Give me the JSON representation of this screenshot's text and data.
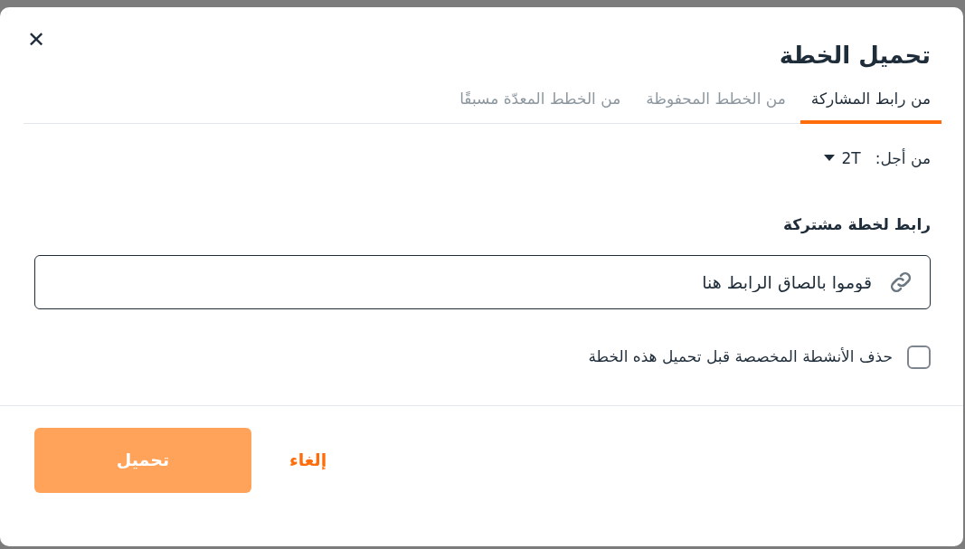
{
  "dialog": {
    "title": "تحميل الخطة",
    "close": "✕"
  },
  "tabs": [
    {
      "label": "من رابط المشاركة",
      "selected": true
    },
    {
      "label": "من الخطط المحفوظة",
      "selected": false
    },
    {
      "label": "من الخطط المعدّة مسبقًا",
      "selected": false
    }
  ],
  "for_selector": {
    "label": "من أجل:",
    "value": "2T"
  },
  "link_field": {
    "label": "رابط لخطة مشتركة",
    "placeholder": "قوموا بالصاق الرابط هنا"
  },
  "option": {
    "label": "حذف الأنشطة المخصصة قبل تحميل هذه الخطة",
    "checked": false
  },
  "buttons": {
    "submit": {
      "label": "تحميل",
      "disabled": true
    },
    "cancel": {
      "label": "إلغاء"
    }
  }
}
